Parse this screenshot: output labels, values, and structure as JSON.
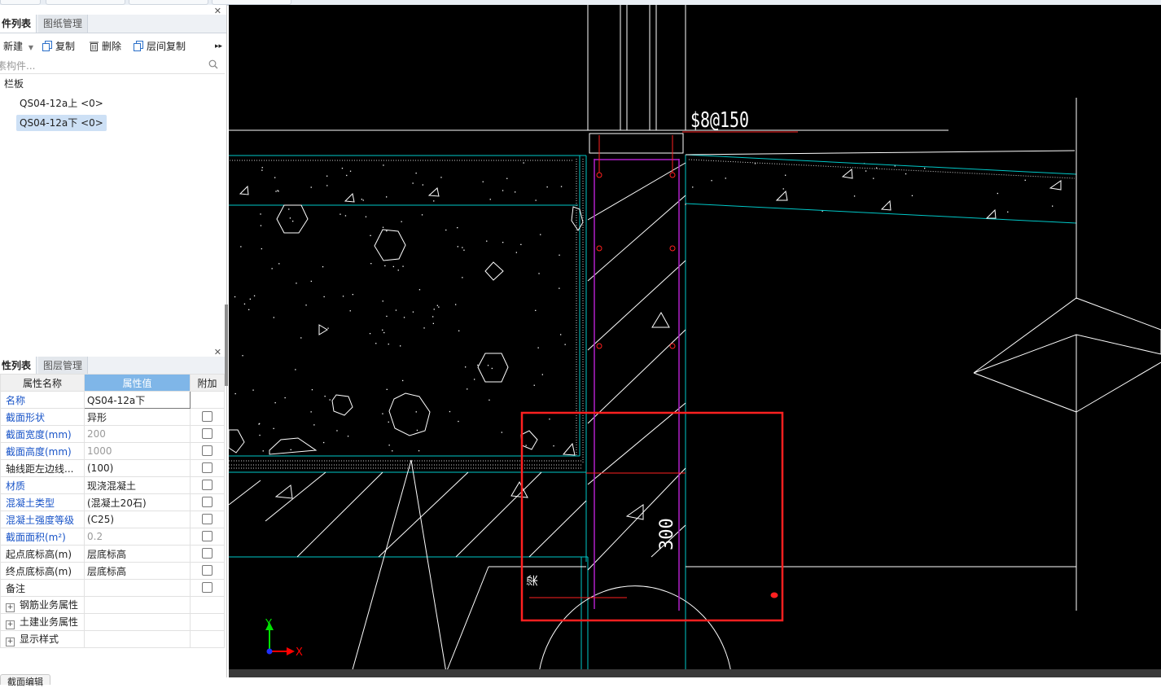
{
  "left_panel": {
    "top_tabs": [
      "件列表",
      "图纸管理"
    ],
    "toolbar": {
      "new_label": "新建",
      "copy_label": "复制",
      "delete_label": "删除",
      "floor_copy_label": "层间复制",
      "more": "▸▸"
    },
    "search_placeholder": "素构件...",
    "tree": {
      "category": "栏板",
      "items": [
        "QS04-12a上 <0>",
        "QS04-12a下 <0>"
      ],
      "selected_index": 1
    },
    "bottom_tabs": [
      "性列表",
      "图层管理"
    ],
    "property_headers": [
      "属性名称",
      "属性值",
      "附加"
    ],
    "properties": [
      {
        "name": "名称",
        "value": "QS04-12a下",
        "name_style": "blue",
        "value_style": "edit",
        "checkbox": false
      },
      {
        "name": "截面形状",
        "value": "异形",
        "name_style": "blue",
        "value_style": "normal",
        "checkbox": true
      },
      {
        "name": "截面宽度(mm)",
        "value": "200",
        "name_style": "blue",
        "value_style": "gray",
        "checkbox": true
      },
      {
        "name": "截面高度(mm)",
        "value": "1000",
        "name_style": "blue",
        "value_style": "gray",
        "checkbox": true
      },
      {
        "name": "轴线距左边线...",
        "value": "(100)",
        "name_style": "normal",
        "value_style": "normal",
        "checkbox": true
      },
      {
        "name": "材质",
        "value": "现浇混凝土",
        "name_style": "blue",
        "value_style": "normal",
        "checkbox": true
      },
      {
        "name": "混凝土类型",
        "value": "(混凝土20石)",
        "name_style": "blue",
        "value_style": "normal",
        "checkbox": true
      },
      {
        "name": "混凝土强度等级",
        "value": "(C25)",
        "name_style": "blue",
        "value_style": "normal",
        "checkbox": true
      },
      {
        "name": "截面面积(m²)",
        "value": "0.2",
        "name_style": "blue",
        "value_style": "gray",
        "checkbox": true
      },
      {
        "name": "起点底标高(m)",
        "value": "层底标高",
        "name_style": "normal",
        "value_style": "normal",
        "checkbox": true
      },
      {
        "name": "终点底标高(m)",
        "value": "层底标高",
        "name_style": "normal",
        "value_style": "normal",
        "checkbox": true
      },
      {
        "name": "备注",
        "value": "",
        "name_style": "normal",
        "value_style": "normal",
        "checkbox": true
      }
    ],
    "groups": [
      "钢筋业务属性",
      "土建业务属性",
      "显示样式"
    ],
    "bottom_label": "截面编辑"
  },
  "cad": {
    "rebar_label": "$8@150",
    "dim_label": "300",
    "beam_label": "梁",
    "axis_x": "X",
    "axis_y": "Y",
    "colors": {
      "background": "#000000",
      "line": "#ffffff",
      "cyan": "#00c8c8",
      "magenta": "#b020c8",
      "red": "#ff2020",
      "axis_green": "#00e000",
      "axis_red": "#ff0000"
    }
  }
}
